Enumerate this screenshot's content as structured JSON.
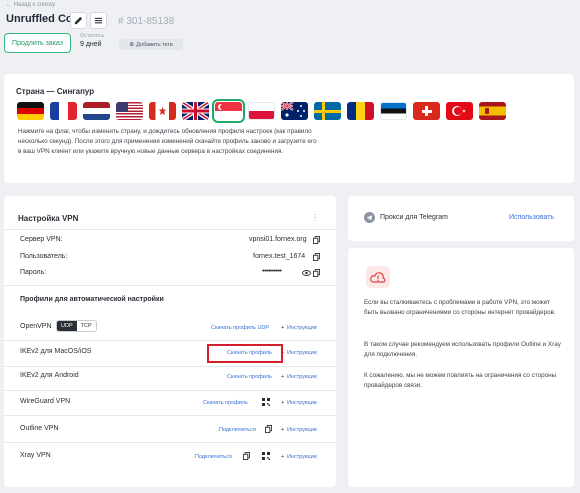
{
  "header": {
    "back_link": "← Назад к списку",
    "title": "Unruffled Cori",
    "order_number": "# 301-85138",
    "extend_button": "Продлить заказ",
    "remaining_label": "Осталось",
    "remaining_value": "9 дней",
    "add_tags_button": "Добавить теги"
  },
  "country": {
    "title": "Страна — Сингапур",
    "description": "Нажмите на флаг, чтобы изменить страну, и дождитесь обновления профиля настроек (как правило несколько секунд). После этого для применения изменений скачайте профиль заново и загрузите его в ваш VPN клиент или укажите вручную новые данные сервера в настройках соединения.",
    "flags": [
      "de",
      "fr",
      "nl",
      "us",
      "ca",
      "gb",
      "sg",
      "pl",
      "au",
      "se",
      "ro",
      "ee",
      "ch",
      "tr",
      "es"
    ],
    "selected": "sg"
  },
  "vpn": {
    "title": "Настройка VPN",
    "server_label": "Сервер VPN:",
    "server_value": "vpnsi01.fornex.org",
    "user_label": "Пользователь:",
    "user_value": "fornex.test_1674",
    "password_label": "Пароль:",
    "password_value": "••••••••••",
    "profiles_title": "Профили для автоматической настройки",
    "rows": [
      {
        "name": "OpenVPN",
        "download": "Скачать профиль UDP",
        "instructions": "Инструкции"
      },
      {
        "name": "IKEv2 для MacOS/iOS",
        "download": "Скачать профиль",
        "instructions": "Инструкции"
      },
      {
        "name": "IKEv2 для Android",
        "download": "Скачать профиль",
        "instructions": "Инструкции"
      },
      {
        "name": "WireGuard VPN",
        "download": "Скачать профиль",
        "instructions": "Инструкции"
      },
      {
        "name": "Outline VPN",
        "download": "Подключиться",
        "instructions": "Инструкции"
      },
      {
        "name": "Xray VPN",
        "download": "Подключиться",
        "instructions": "Инструкции"
      }
    ],
    "udp": "UDP",
    "tcp": "TCP"
  },
  "telegram": {
    "label": "Прокси для Telegram",
    "link": "Использовать"
  },
  "warning": {
    "p1": "Если вы сталкиваетесь с проблемами в работе VPN, это может быть вызвано ограничениями со стороны интернет провайдеров.",
    "p2": "В таком случае рекомендуем использовать профили Outline и Xray для подключения.",
    "p3": "К сожалению, мы не можем повлиять на ограничения со стороны провайдеров связи."
  },
  "colors": {
    "accent_green": "#35b87c",
    "link_blue": "#3b6fd8",
    "highlight_red": "#d21f2b"
  }
}
